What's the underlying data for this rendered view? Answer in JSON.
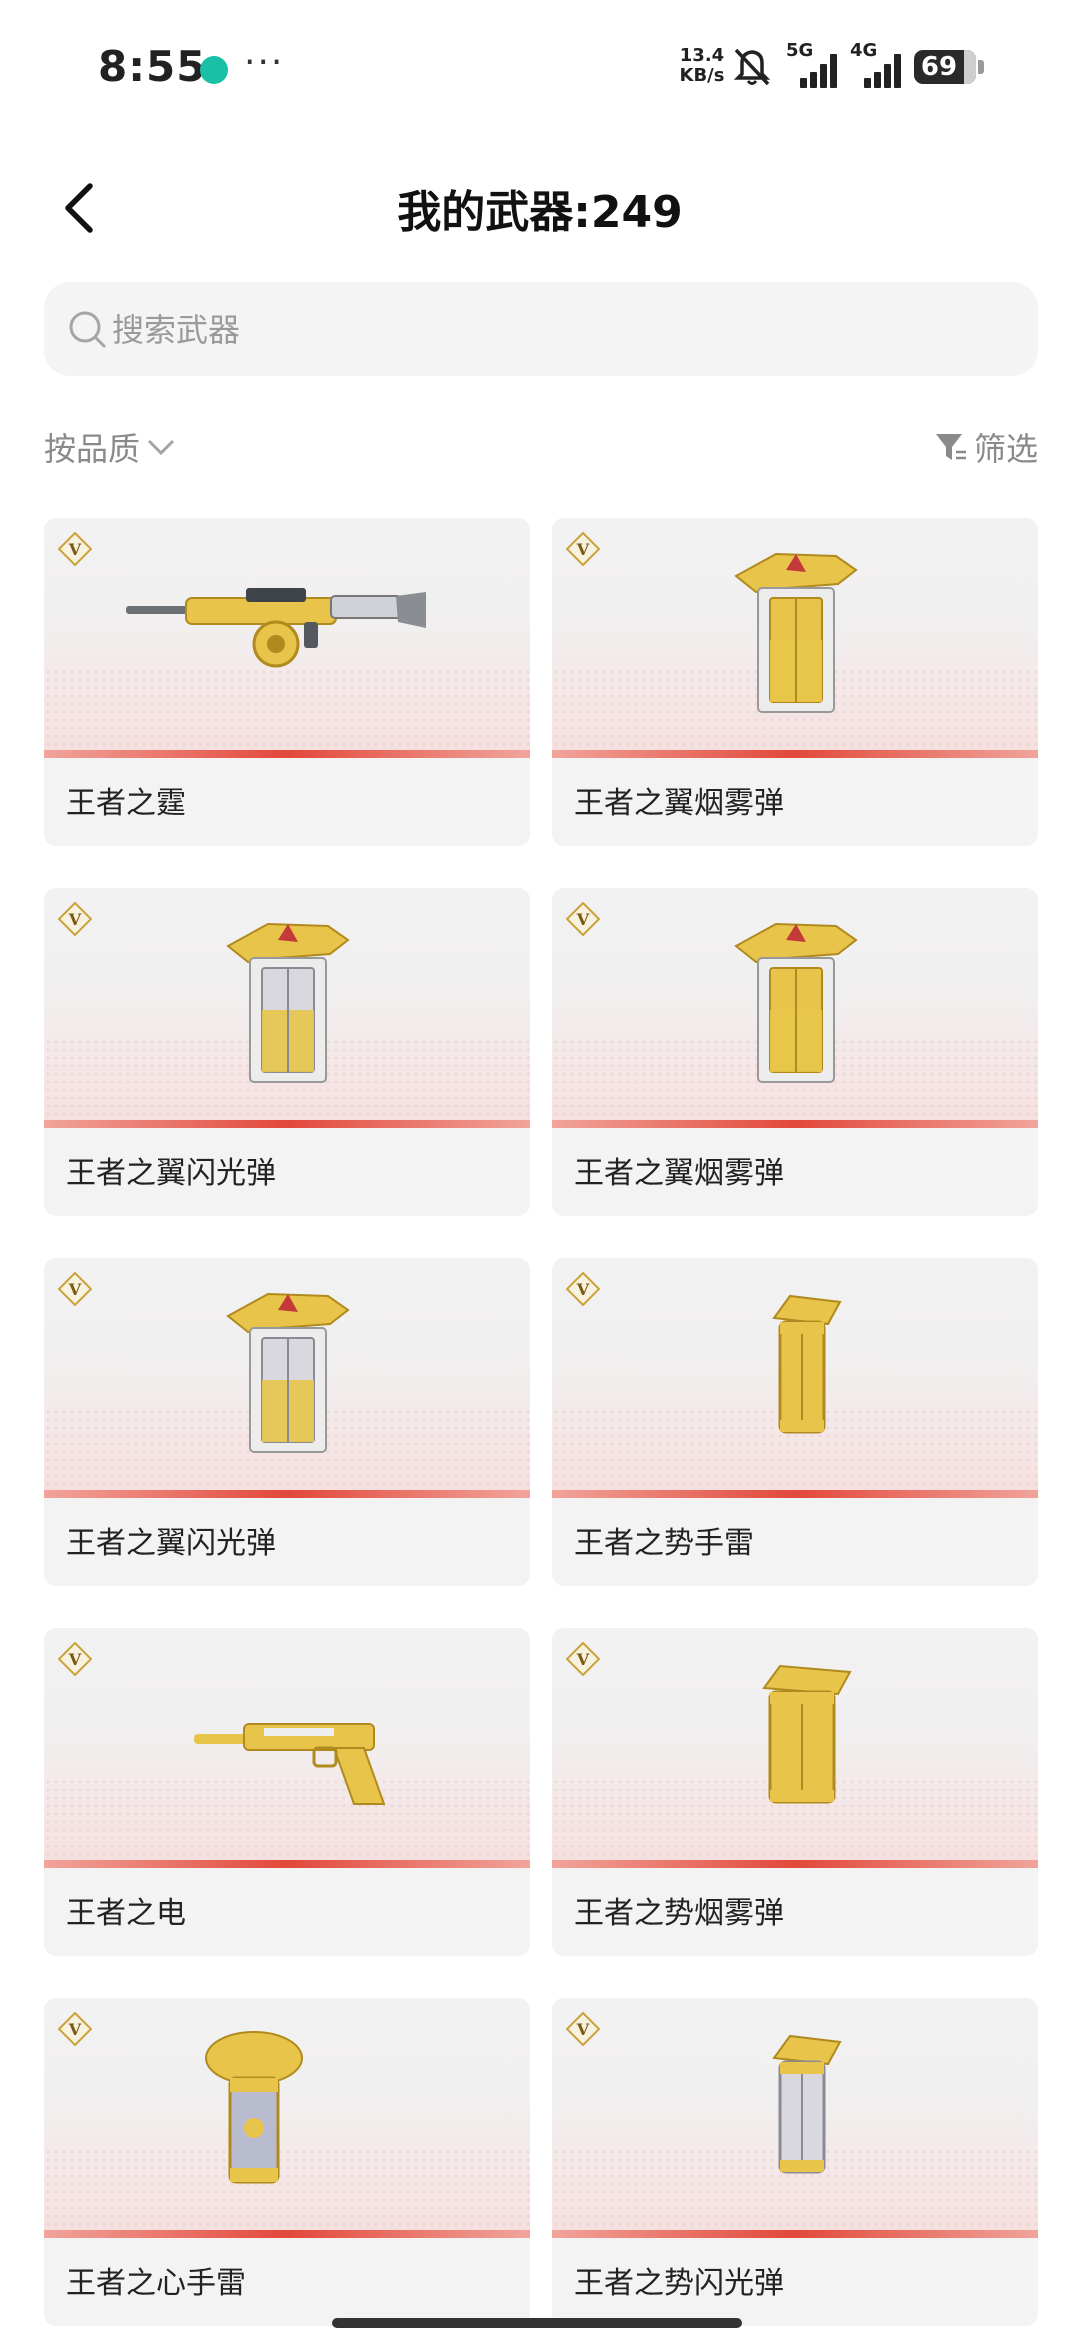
{
  "status_bar": {
    "time": "8:55",
    "more": "···",
    "net_speed_value": "13.4",
    "net_speed_unit": "KB/s",
    "sim1_label": "5G",
    "sim2_label": "4G",
    "battery": "69"
  },
  "header": {
    "title": "我的武器:249"
  },
  "search": {
    "placeholder": "搜索武器"
  },
  "toolbar": {
    "sort_label": "按品质",
    "filter_label": "筛选"
  },
  "weapons": [
    {
      "name": "王者之霆",
      "kind": "rifle",
      "badge": "V"
    },
    {
      "name": "王者之翼烟雾弹",
      "kind": "canister-gold",
      "badge": "V"
    },
    {
      "name": "王者之翼闪光弹",
      "kind": "canister-silver",
      "badge": "V"
    },
    {
      "name": "王者之翼烟雾弹",
      "kind": "canister-gold",
      "badge": "V"
    },
    {
      "name": "王者之翼闪光弹",
      "kind": "canister-silver",
      "badge": "V"
    },
    {
      "name": "王者之势手雷",
      "kind": "grenade-small",
      "badge": "V"
    },
    {
      "name": "王者之电",
      "kind": "pistol",
      "badge": "V"
    },
    {
      "name": "王者之势烟雾弹",
      "kind": "grenade-wide",
      "badge": "V"
    },
    {
      "name": "王者之心手雷",
      "kind": "grenade-lion",
      "badge": "V"
    },
    {
      "name": "王者之势闪光弹",
      "kind": "grenade-silver",
      "badge": "V"
    }
  ],
  "colors": {
    "accent_red": "#e2483b",
    "gold": "#d9b23a",
    "text_muted": "#8a8a8a"
  }
}
